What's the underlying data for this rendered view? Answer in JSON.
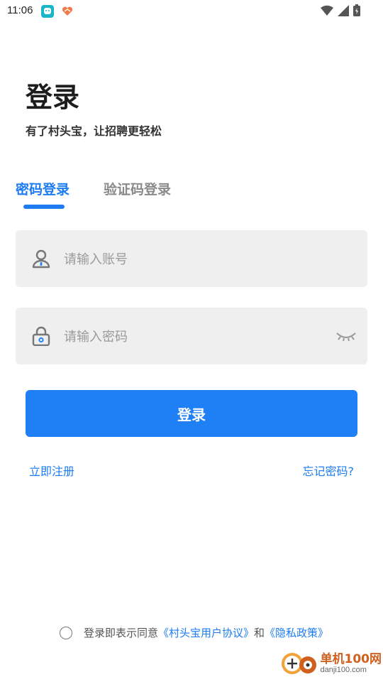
{
  "status_bar": {
    "time": "11:06",
    "icons": [
      "app-icon",
      "heart-icon",
      "wifi-icon",
      "signal-icon",
      "battery-icon"
    ]
  },
  "header": {
    "title": "登录",
    "subtitle": "有了村头宝，让招聘更轻松"
  },
  "tabs": [
    {
      "label": "密码登录",
      "active": true
    },
    {
      "label": "验证码登录",
      "active": false
    }
  ],
  "form": {
    "account_placeholder": "请输入账号",
    "account_value": "",
    "password_placeholder": "请输入密码",
    "password_value": ""
  },
  "login_button": "登录",
  "links": {
    "register": "立即注册",
    "forgot": "忘记密码?"
  },
  "agreement": {
    "checked": false,
    "prefix": "登录即表示同意",
    "user_agreement": "《村头宝用户协议》",
    "and": "和",
    "privacy_policy": "《隐私政策》"
  },
  "watermark": {
    "cn": "单机100网",
    "en": "danji100.com"
  },
  "colors": {
    "accent": "#1f7ff5",
    "field_bg": "#efefef",
    "watermark": "#d0601e"
  }
}
